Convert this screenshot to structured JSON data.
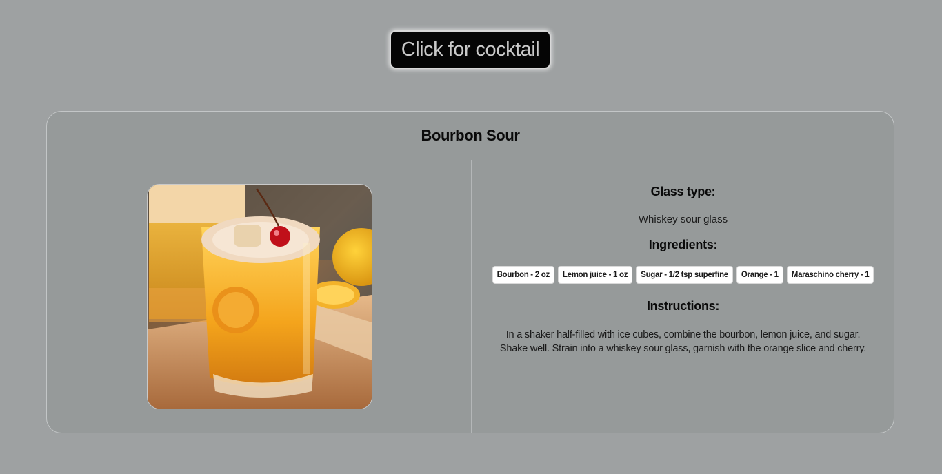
{
  "button": {
    "label": "Click for cocktail"
  },
  "cocktail": {
    "name": "Bourbon Sour",
    "image_alt": "Bourbon Sour",
    "glass_heading": "Glass type:",
    "glass": "Whiskey sour glass",
    "ingredients_heading": "Ingredients:",
    "ingredients": [
      "Bourbon - 2 oz",
      "Lemon juice - 1 oz",
      "Sugar - 1/2 tsp superfine",
      "Orange - 1",
      "Maraschino cherry - 1"
    ],
    "instructions_heading": "Instructions:",
    "instructions": "In a shaker half-filled with ice cubes, combine the bourbon, lemon juice, and sugar. Shake well. Strain into a whiskey sour glass, garnish with the orange slice and cherry."
  },
  "colors": {
    "background": "#9ea1a2",
    "card": "#969a9a",
    "button": "#050505",
    "chip": "#ffffff"
  }
}
